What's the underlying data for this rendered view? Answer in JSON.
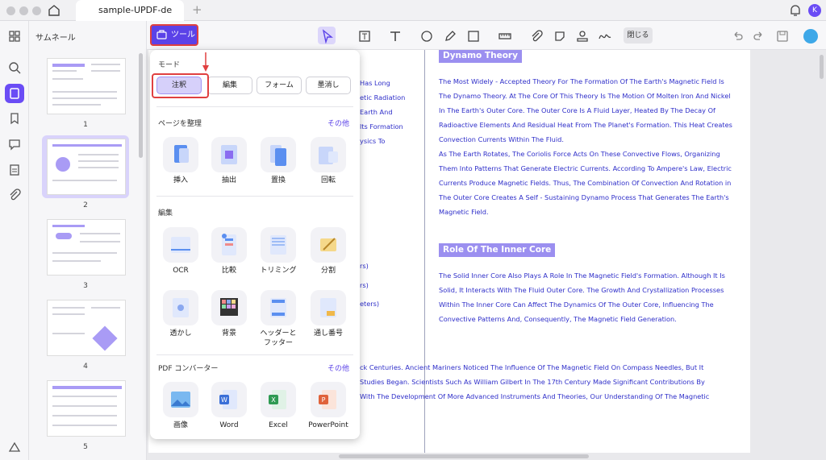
{
  "window": {
    "tab_title": "sample-UPDF-de",
    "avatar_initial": "K"
  },
  "thumbnails": {
    "title": "サムネール",
    "pages": [
      "1",
      "2",
      "3",
      "4",
      "5"
    ]
  },
  "toolbar": {
    "tools_label": "ツール",
    "close_label": "閉じる"
  },
  "popup": {
    "mode_label": "モード",
    "modes": [
      "注釈",
      "編集",
      "フォーム",
      "墨消し"
    ],
    "organize": {
      "label": "ページを整理",
      "more": "その他",
      "items": [
        "挿入",
        "抽出",
        "置換",
        "回転"
      ]
    },
    "edit": {
      "label": "編集",
      "items": [
        "OCR",
        "比較",
        "トリミング",
        "分割",
        "透かし",
        "背景",
        "ヘッダーと\nフッター",
        "通し番号"
      ]
    },
    "converter": {
      "label": "PDF コンバーター",
      "more": "その他",
      "items": [
        "画像",
        "Word",
        "Excel",
        "PowerPoint"
      ]
    }
  },
  "document": {
    "left_fragments": [
      "Has Long",
      "etic Radiation",
      "Earth And",
      "lts Formation",
      "ysics To",
      "rs)",
      "rs)",
      "eters)"
    ],
    "heading1": "Dynamo Theory",
    "para1": [
      "The Most Widely - Accepted Theory For The Formation Of The Earth's Magnetic Field Is",
      "The Dynamo Theory. At The Core Of This Theory Is The Motion Of Molten Iron And Nickel",
      "In The Earth's Outer Core. The Outer Core Is A Fluid Layer, Heated By The Decay Of",
      "Radioactive Elements And Residual Heat From The Planet's Formation. This Heat Creates",
      "Convection Currents Within The Fluid.",
      "As The Earth Rotates, The Coriolis Force Acts On These Convective Flows, Organizing",
      "Them Into Patterns That Generate Electric Currents. According To Ampere's Law, Electric",
      "Currents Produce Magnetic Fields. Thus, The Combination Of Convection And Rotation in",
      "The Outer Core Creates A Self - Sustaining Dynamo Process That Generates The Earth's",
      "Magnetic Field."
    ],
    "heading2": "Role Of The Inner Core",
    "para2": [
      "The Solid Inner Core Also Plays A Role In The Magnetic Field's Formation. Although It Is",
      "Solid, It Interacts With The Fluid Outer Core. The Growth And Crystallization Processes",
      "Within The Inner Core Can Affect The Dynamics Of The Outer Core, Influencing The",
      "Convective Patterns And, Consequently, The Magnetic Field Generation."
    ],
    "bottom_lines": [
      "ck Centuries. Ancient Mariners Noticed The Influence Of The Magnetic Field On Compass Needles, But It",
      "Studies Began. Scientists Such As William Gilbert In The 17th Century Made Significant Contributions By",
      "With The Development Of More Advanced Instruments And Theories, Our Understanding Of The Magnetic"
    ]
  },
  "colors": {
    "accent": "#5b42e8",
    "highlight_red": "#e04040",
    "doc_text": "#2e2ec9",
    "heading_bg": "#9b8ff0"
  }
}
